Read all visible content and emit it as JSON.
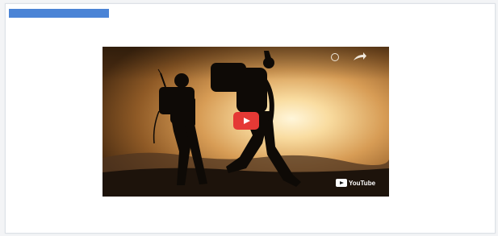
{
  "toolbar": {
    "title": ""
  },
  "caption": "",
  "video": {
    "title": "",
    "platform_label": "YouTube",
    "footer_text": "",
    "icons": {
      "play": "play-button-icon",
      "watch_later": "clock-icon",
      "share": "share-icon",
      "youtube": "youtube-logo"
    }
  },
  "colors": {
    "accent": "#4b84d6",
    "play_red": "#e53935"
  }
}
